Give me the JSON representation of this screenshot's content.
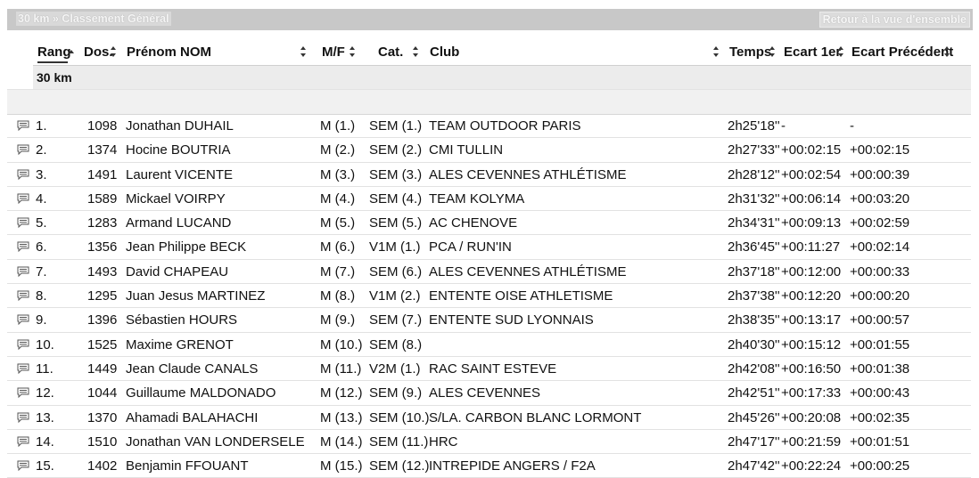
{
  "topbar": {
    "breadcrumb": "30 km » Classement Général",
    "back_link": "Retour à la vue d'ensemble"
  },
  "columns": {
    "rang": "Rang",
    "dos": "Dos.",
    "nom": "Prénom NOM",
    "mf": "M/F",
    "cat": "Cat.",
    "club": "Club",
    "temps": "Temps",
    "ecart1": "Ecart 1er",
    "ecartprec": "Ecart Précédent"
  },
  "group_label": "30 km",
  "rows": [
    {
      "rang": "1.",
      "dos": "1098",
      "nom": "Jonathan DUHAIL",
      "mf": "M (1.)",
      "cat": "SEM (1.)",
      "club": "TEAM OUTDOOR PARIS",
      "temps": "2h25'18''",
      "ecart1": "-",
      "ecartprec": "-"
    },
    {
      "rang": "2.",
      "dos": "1374",
      "nom": "Hocine BOUTRIA",
      "mf": "M (2.)",
      "cat": "SEM (2.)",
      "club": "CMI TULLIN",
      "temps": "2h27'33''",
      "ecart1": "+00:02:15",
      "ecartprec": "+00:02:15"
    },
    {
      "rang": "3.",
      "dos": "1491",
      "nom": "Laurent VICENTE",
      "mf": "M (3.)",
      "cat": "SEM (3.)",
      "club": "ALES CEVENNES ATHLÉTISME",
      "temps": "2h28'12''",
      "ecart1": "+00:02:54",
      "ecartprec": "+00:00:39"
    },
    {
      "rang": "4.",
      "dos": "1589",
      "nom": "Mickael VOIRPY",
      "mf": "M (4.)",
      "cat": "SEM (4.)",
      "club": "TEAM KOLYMA",
      "temps": "2h31'32''",
      "ecart1": "+00:06:14",
      "ecartprec": "+00:03:20"
    },
    {
      "rang": "5.",
      "dos": "1283",
      "nom": "Armand LUCAND",
      "mf": "M (5.)",
      "cat": "SEM (5.)",
      "club": "AC CHENOVE",
      "temps": "2h34'31''",
      "ecart1": "+00:09:13",
      "ecartprec": "+00:02:59"
    },
    {
      "rang": "6.",
      "dos": "1356",
      "nom": "Jean Philippe BECK",
      "mf": "M (6.)",
      "cat": "V1M (1.)",
      "club": "PCA / RUN'IN",
      "temps": "2h36'45''",
      "ecart1": "+00:11:27",
      "ecartprec": "+00:02:14"
    },
    {
      "rang": "7.",
      "dos": "1493",
      "nom": "David CHAPEAU",
      "mf": "M (7.)",
      "cat": "SEM (6.)",
      "club": "ALES CEVENNES ATHLÉTISME",
      "temps": "2h37'18''",
      "ecart1": "+00:12:00",
      "ecartprec": "+00:00:33"
    },
    {
      "rang": "8.",
      "dos": "1295",
      "nom": "Juan Jesus MARTINEZ",
      "mf": "M (8.)",
      "cat": "V1M (2.)",
      "club": "ENTENTE OISE ATHLETISME",
      "temps": "2h37'38''",
      "ecart1": "+00:12:20",
      "ecartprec": "+00:00:20"
    },
    {
      "rang": "9.",
      "dos": "1396",
      "nom": "Sébastien HOURS",
      "mf": "M (9.)",
      "cat": "SEM (7.)",
      "club": "ENTENTE SUD LYONNAIS",
      "temps": "2h38'35''",
      "ecart1": "+00:13:17",
      "ecartprec": "+00:00:57"
    },
    {
      "rang": "10.",
      "dos": "1525",
      "nom": "Maxime GRENOT",
      "mf": "M (10.)",
      "cat": "SEM (8.)",
      "club": "",
      "temps": "2h40'30''",
      "ecart1": "+00:15:12",
      "ecartprec": "+00:01:55"
    },
    {
      "rang": "11.",
      "dos": "1449",
      "nom": "Jean Claude CANALS",
      "mf": "M (11.)",
      "cat": "V2M (1.)",
      "club": "RAC SAINT ESTEVE",
      "temps": "2h42'08''",
      "ecart1": "+00:16:50",
      "ecartprec": "+00:01:38"
    },
    {
      "rang": "12.",
      "dos": "1044",
      "nom": "Guillaume MALDONADO",
      "mf": "M (12.)",
      "cat": "SEM (9.)",
      "club": "ALES CEVENNES",
      "temps": "2h42'51''",
      "ecart1": "+00:17:33",
      "ecartprec": "+00:00:43"
    },
    {
      "rang": "13.",
      "dos": "1370",
      "nom": "Ahamadi BALAHACHI",
      "mf": "M (13.)",
      "cat": "SEM (10.)",
      "club": "S/LA. CARBON BLANC LORMONT",
      "temps": "2h45'26''",
      "ecart1": "+00:20:08",
      "ecartprec": "+00:02:35"
    },
    {
      "rang": "14.",
      "dos": "1510",
      "nom": "Jonathan VAN LONDERSELE",
      "mf": "M (14.)",
      "cat": "SEM (11.)",
      "club": "HRC",
      "temps": "2h47'17''",
      "ecart1": "+00:21:59",
      "ecartprec": "+00:01:51"
    },
    {
      "rang": "15.",
      "dos": "1402",
      "nom": "Benjamin FFOUANT",
      "mf": "M (15.)",
      "cat": "SEM (12.)",
      "club": "INTREPIDE ANGERS / F2A",
      "temps": "2h47'42''",
      "ecart1": "+00:22:24",
      "ecartprec": "+00:00:25"
    }
  ]
}
